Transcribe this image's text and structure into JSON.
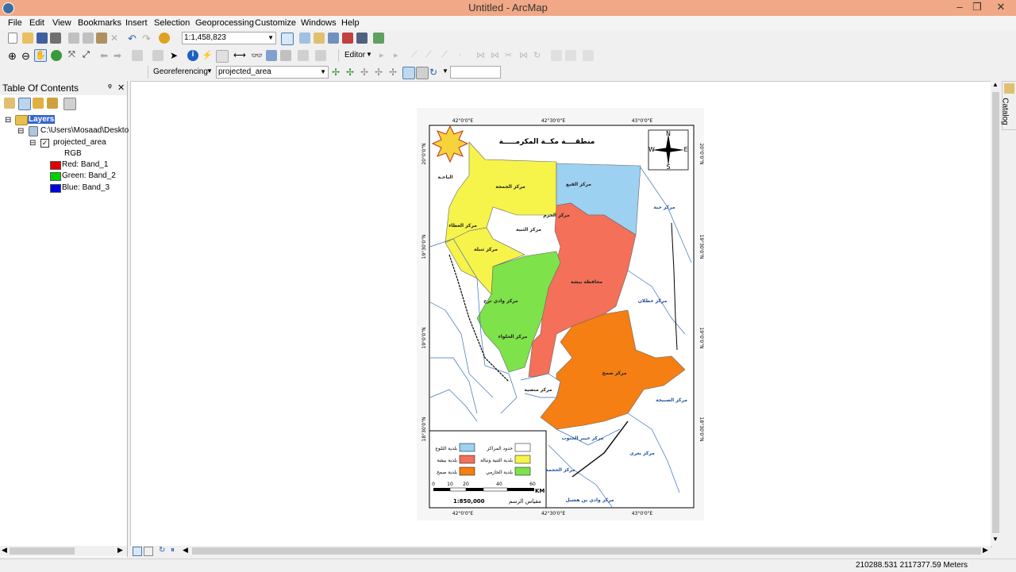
{
  "window": {
    "title": "Untitled - ArcMap",
    "min": "–",
    "max": "❐",
    "close": "✕"
  },
  "menu": [
    "File",
    "Edit",
    "View",
    "Bookmarks",
    "Insert",
    "Selection",
    "Geoprocessing",
    "Customize",
    "Windows",
    "Help"
  ],
  "toolbar": {
    "scale": "1:1,458,823",
    "editor_label": "Editor",
    "georef_label": "Georeferencing",
    "georef_layer": "projected_area",
    "georef_text": ""
  },
  "toc": {
    "title": "Table Of Contents",
    "pin": "ᵠ",
    "close": "✕",
    "layers_label": "Layers",
    "path_label": "C:\\Users\\Mosaad\\Deskto",
    "layer_name": "projected_area",
    "rgb_label": "RGB",
    "bands": [
      {
        "label": "Red:",
        "band": "Band_1",
        "color": "#e00000"
      },
      {
        "label": "Green:",
        "band": "Band_2",
        "color": "#00d000"
      },
      {
        "label": "Blue:",
        "band": "Band_3",
        "color": "#0000e0"
      }
    ]
  },
  "catalog_tab": "Catalog",
  "status": {
    "coords": "210288.531  2117377.59 Meters"
  },
  "map": {
    "title": "منطقــــة مكــة المكرمـــــة",
    "lon_labels": [
      "42°0'0\"E",
      "42°30'0\"E",
      "43°0'0\"E"
    ],
    "lat_labels": [
      "20°0'0\"N",
      "19°30'0\"N",
      "19°0'0\"N",
      "18°30'0\"N"
    ],
    "compass": {
      "n": "N",
      "s": "S",
      "e": "E",
      "w": "W"
    },
    "region_labels": [
      "مركز الجمجة",
      "مركز الفيع",
      "مركز العطاء",
      "مركز الثنية",
      "مركز ثنيلة",
      "مركز حبة",
      "مركز الخرم",
      "محافظة بيشة",
      "مركز وادي ترج",
      "مركز الحلواء",
      "مركز صمخ",
      "مركز خطلان",
      "مركز منصية",
      "مركز الصبيخة",
      "مركز خيبر الجنوب",
      "مركز يعرى",
      "مركز الحجمة",
      "مركز وادي بن هشبل",
      "الباحـة"
    ],
    "legend": [
      {
        "label": "حدود المراكز",
        "color": "#ffffff"
      },
      {
        "label": "بلدية الثلوع",
        "color": "#9cd1f2"
      },
      {
        "label": "بلدية الثنية وتبالة",
        "color": "#f6f34b"
      },
      {
        "label": "بلدية بيشة",
        "color": "#f47058"
      },
      {
        "label": "بلدية الحازمي",
        "color": "#7ee24a"
      },
      {
        "label": "بلدية صمخ",
        "color": "#f57f12"
      }
    ],
    "scale_ticks": [
      "0",
      "10",
      "20",
      "40",
      "60"
    ],
    "scale_unit": "KM",
    "scale_ratio": "1:850,000",
    "scale_caption": "مقياس الرسم"
  }
}
